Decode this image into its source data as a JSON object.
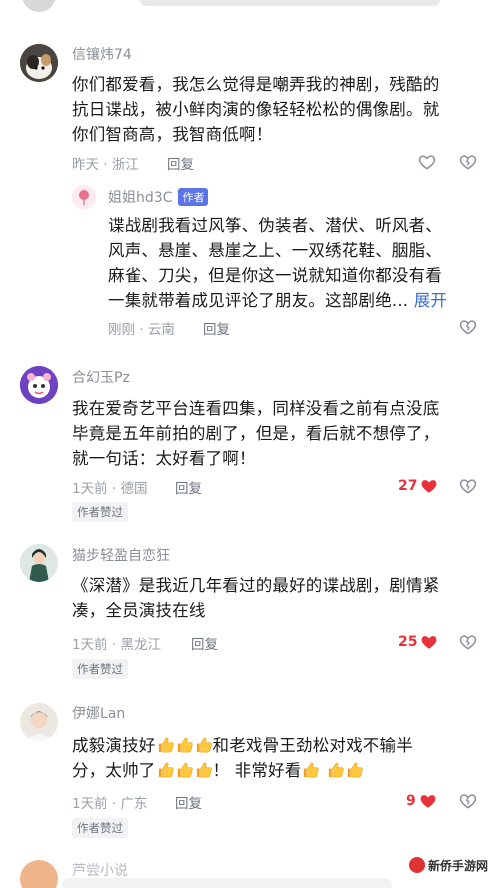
{
  "comments": [
    {
      "username": "信镶炜74",
      "text_lines": [
        "你们都爱看，我怎么觉得是嘲弄我的神剧，残酷的",
        "抗日谍战，被小鲜肉演的像轻轻松松的偶像剧。就",
        "你们智商高，我智商低啊！"
      ],
      "meta": "昨天 · 浙江",
      "reply_label": "回复"
    },
    {
      "username": "合幻玉Pz",
      "text_lines": [
        "我在爱奇艺平台连看四集，同样没看之前有点没底",
        "毕竟是五年前拍的剧了，但是，看后就不想停了，",
        "就一句话：太好看了啊！"
      ],
      "meta": "1天前 · 德国",
      "reply_label": "回复",
      "like_count": "27",
      "badge": "作者赞过"
    },
    {
      "username": "猫步轻盈自恋狂",
      "text_lines": [
        "《深潜》是我近几年看过的最好的谍战剧，剧情紧",
        "凑，全员演技在线"
      ],
      "meta": "1天前 · 黑龙江",
      "reply_label": "回复",
      "like_count": "25",
      "badge": "作者赞过"
    },
    {
      "username": "伊娜Lan",
      "line1_a": "成毅演技好",
      "line1_b": "和老戏骨王劲松对戏不输半",
      "line2_a": "分，太帅了",
      "line2_b": "！ 非常好看",
      "meta": "1天前 · 广东",
      "reply_label": "回复",
      "like_count": "9",
      "badge": "作者赞过"
    }
  ],
  "reply": {
    "username": "姐姐hd3C",
    "author_tag": "作者",
    "text_lines": [
      "谍战剧我看过风筝、伪装者、潜伏、听风者、",
      "风声、悬崖、悬崖之上、一双绣花鞋、胭脂、",
      "麻雀、刀尖，但是你这一说就知道你都没有看",
      "一集就带着成见评论了朋友。这部剧绝..."
    ],
    "expand_label": "展开",
    "meta": "刚刚 · 云南",
    "reply_label": "回复"
  },
  "next_username_partial": "芦尝小说",
  "watermark": "新侨手游网",
  "colors": {
    "like_red": "#e8313a",
    "author_tag_bg": "#5b74e8",
    "expand_blue": "#3b6fd8",
    "meta_gray": "#9aa0a8"
  }
}
